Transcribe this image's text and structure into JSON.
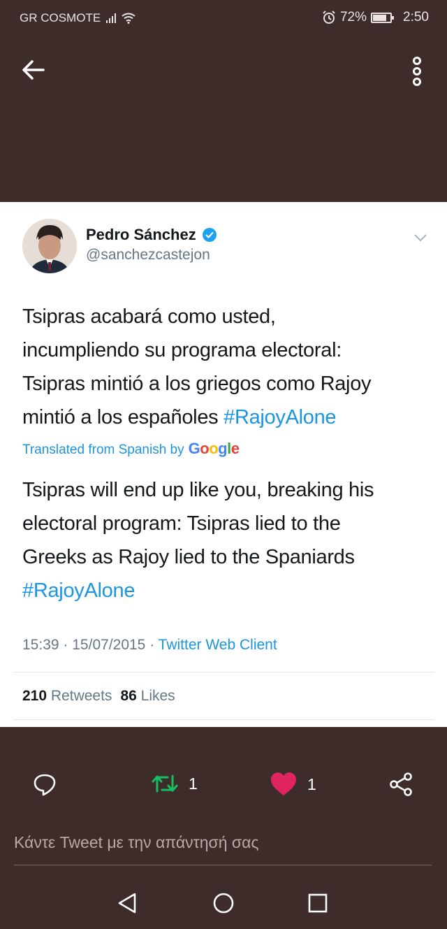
{
  "status_bar": {
    "carrier": "GR COSMOTE",
    "battery": "72%",
    "time": "2:50"
  },
  "header": {
    "back_icon": "arrow-left-icon",
    "menu_icon": "more-vertical-icon"
  },
  "tweet": {
    "author_name": "Pedro Sánchez",
    "verified": true,
    "handle": "@sanchezcastejon",
    "text_lines": [
      "Tsipras acabará como usted,",
      "incumpliendo su programa electoral:",
      "Tsipras mintió a los griegos como Rajoy",
      "mintió a los españoles "
    ],
    "hashtag": "#RajoyAlone",
    "translated_label": "Translated from Spanish by",
    "translator": "Google",
    "translation_lines": [
      "Tsipras will end up like you, breaking his",
      "electoral program: Tsipras lied to the",
      "Greeks as Rajoy lied to the Spaniards"
    ],
    "translation_hashtag": "#RajoyAlone",
    "time": "15:39",
    "date": "15/07/2015",
    "separator": "·",
    "client": "Twitter Web Client",
    "retweets_count": "210",
    "retweets_label": "Retweets",
    "likes_count": "86",
    "likes_label": "Likes"
  },
  "actions": {
    "retweet_count": "1",
    "like_count": "1"
  },
  "reply": {
    "placeholder": "Κάντε Tweet με την απάντησή σας"
  },
  "colors": {
    "background": "#3d2c2a",
    "link": "#1b95e0",
    "retweet": "#17bf63",
    "like": "#e0245e"
  }
}
